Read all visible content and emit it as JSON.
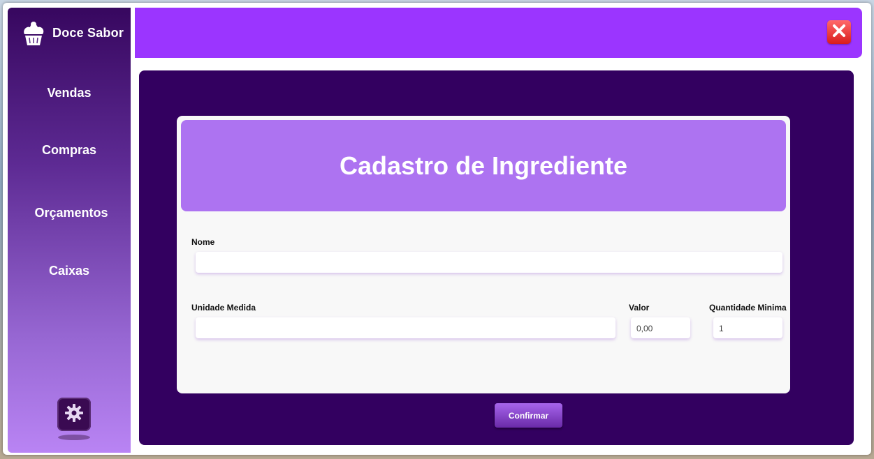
{
  "app": {
    "name": "Doce Sabor",
    "brand_icon": "cupcake-icon"
  },
  "sidebar": {
    "items": [
      {
        "label": "Vendas"
      },
      {
        "label": "Compras"
      },
      {
        "label": "Orçamentos"
      },
      {
        "label": "Caixas"
      }
    ],
    "settings_icon": "gear-icon"
  },
  "topbar": {
    "close_icon": "close-icon"
  },
  "form": {
    "title": "Cadastro de Ingrediente",
    "fields": {
      "nome": {
        "label": "Nome",
        "value": ""
      },
      "unidade": {
        "label": "Unidade Medida",
        "value": ""
      },
      "valor": {
        "label": "Valor",
        "value": "0,00"
      },
      "quantidade": {
        "label": "Quantidade Minima",
        "value": "1"
      }
    },
    "confirm_label": "Confirmar"
  },
  "colors": {
    "topbar": "#9b35ff",
    "content_bg": "#330060",
    "form_header": "#ad73f1",
    "sidebar_top": "#37075f",
    "sidebar_bottom": "#b984f4"
  }
}
